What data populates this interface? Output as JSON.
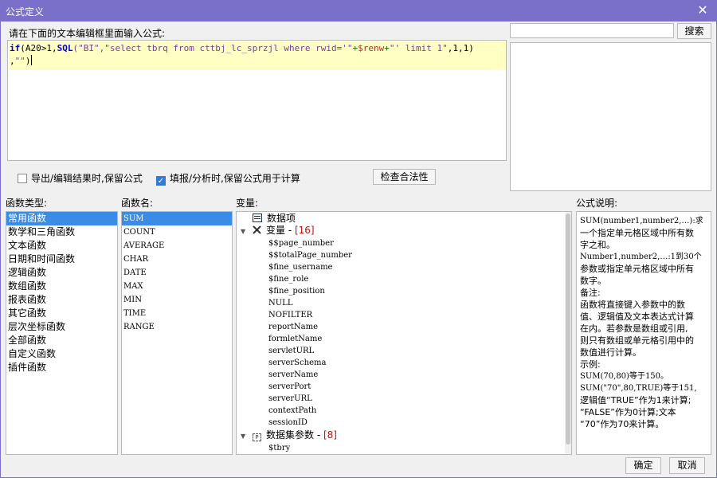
{
  "window": {
    "title": "公式定义",
    "close_icon": "close-icon"
  },
  "editor": {
    "prompt": "请在下面的文本编辑框里面输入公式:",
    "line1": {
      "t1": "if",
      "t2": "(A20>1,",
      "t3": "SQL",
      "t4": "(\"BI\",",
      "t5": "\"select tbrq from cttbj_lc_sprzjl where rwid='\"",
      "t6": "+",
      "t7": "$renw",
      "t8": "+",
      "t9": "\"' limit 1\"",
      "t10": ",1,1)"
    },
    "line2": {
      "t1": ",",
      "t2": "\"\"",
      "t3": ")"
    }
  },
  "search": {
    "value": "",
    "button_label": "搜索"
  },
  "options": {
    "export_keep": {
      "label": "导出/编辑结果时,保留公式",
      "checked": false
    },
    "fill_keep": {
      "label": "填报/分析时,保留公式用于计算",
      "checked": true
    },
    "check_button": "检查合法性"
  },
  "labels": {
    "func_type": "函数类型:",
    "func_name": "函数名:",
    "variable": "变量:",
    "description": "公式说明:"
  },
  "function_types": [
    "常用函数",
    "数学和三角函数",
    "文本函数",
    "日期和时间函数",
    "逻辑函数",
    "数组函数",
    "报表函数",
    "其它函数",
    "层次坐标函数",
    "全部函数",
    "自定义函数",
    "插件函数"
  ],
  "function_names": [
    "SUM",
    "COUNT",
    "AVERAGE",
    "CHAR",
    "DATE",
    "MAX",
    "MIN",
    "TIME",
    "RANGE"
  ],
  "variables": {
    "data_item": "数据项",
    "var_group": {
      "label": "变量 - ",
      "count": "[16]"
    },
    "vars": [
      "$$page_number",
      "$$totalPage_number",
      "$fine_username",
      "$fine_role",
      "$fine_position",
      "NULL",
      "NOFILTER",
      "reportName",
      "formletName",
      "servletURL",
      "serverSchema",
      "serverName",
      "serverPort",
      "serverURL",
      "contextPath",
      "sessionID"
    ],
    "dataset_group": {
      "label": "数据集参数 - ",
      "count": "[8]"
    },
    "dataset_vars": [
      "$tbry"
    ]
  },
  "description": [
    "SUM(number1,number2,…):求",
    "一个指定单元格区域中所有数",
    "字之和。",
    "Number1,number2,…:1到30个",
    "参数或指定单元格区域中所有",
    "数字。",
    "备注:",
    "函数将直接键入参数中的数",
    "值、逻辑值及文本表达式计算",
    "在内。若参数是数组或引用,",
    "则只有数组或单元格引用中的",
    "数值进行计算。",
    "示例:",
    "SUM(70,80)等于150。",
    "SUM(\"70\",80,TRUE)等于151,",
    "逻辑值“TRUE”作为1来计算;",
    "“FALSE”作为0计算;文本",
    "“70”作为70来计算。"
  ],
  "buttons": {
    "ok": "确定",
    "cancel": "取消"
  },
  "colors": {
    "titlebar": "#7a6fc9",
    "selection": "#3b8ce6",
    "highlight_line": "#ffffc3"
  }
}
